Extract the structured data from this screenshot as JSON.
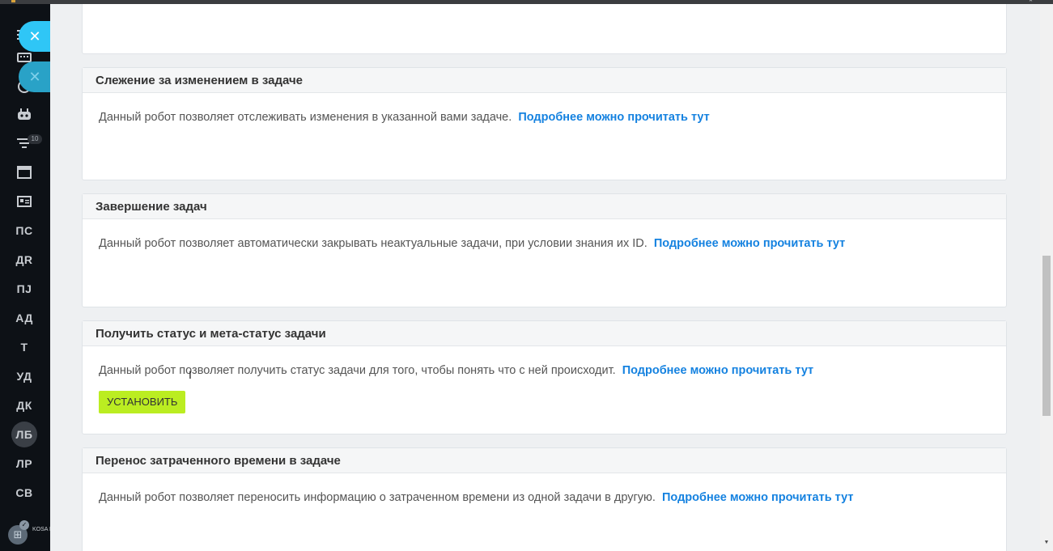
{
  "sidebar": {
    "badge": "10",
    "items": [
      {
        "label": "ПС"
      },
      {
        "label": "ДR"
      },
      {
        "label": "ПJ"
      },
      {
        "label": "АД"
      },
      {
        "label": "Т"
      },
      {
        "label": "УД"
      },
      {
        "label": "ДК"
      },
      {
        "label": "ЛБ"
      },
      {
        "label": "ЛР"
      },
      {
        "label": "СВ"
      }
    ],
    "logo_text": "KOSA ВСЁ"
  },
  "cards": [
    {
      "title": "Слежение за изменением в задаче",
      "description": "Данный робот позволяет отслеживать изменения в указанной вами задаче.",
      "link": "Подробнее можно прочитать тут"
    },
    {
      "title": "Завершение задач",
      "description": "Данный робот позволяет автоматически закрывать неактуальные задачи, при условии знания их ID.",
      "link": "Подробнее можно прочитать тут"
    },
    {
      "title": "Получить статус и мета-статус задачи",
      "description": "Данный робот позволяет получить статус задачи для того, чтобы понять что с ней происходит.",
      "link": "Подробнее можно прочитать тут",
      "button": "УСТАНОВИТЬ"
    },
    {
      "title": "Перенос затраченного времени в задаче",
      "description": "Данный робот позволяет переносить информацию о затраченном времени из одной задачи в другую.",
      "link": "Подробнее можно прочитать тут"
    }
  ],
  "colors": {
    "accent_link": "#1582e0",
    "install_button": "#bbed21",
    "sidebar_bg": "#0d1116",
    "fab": "#2fc6f6"
  }
}
